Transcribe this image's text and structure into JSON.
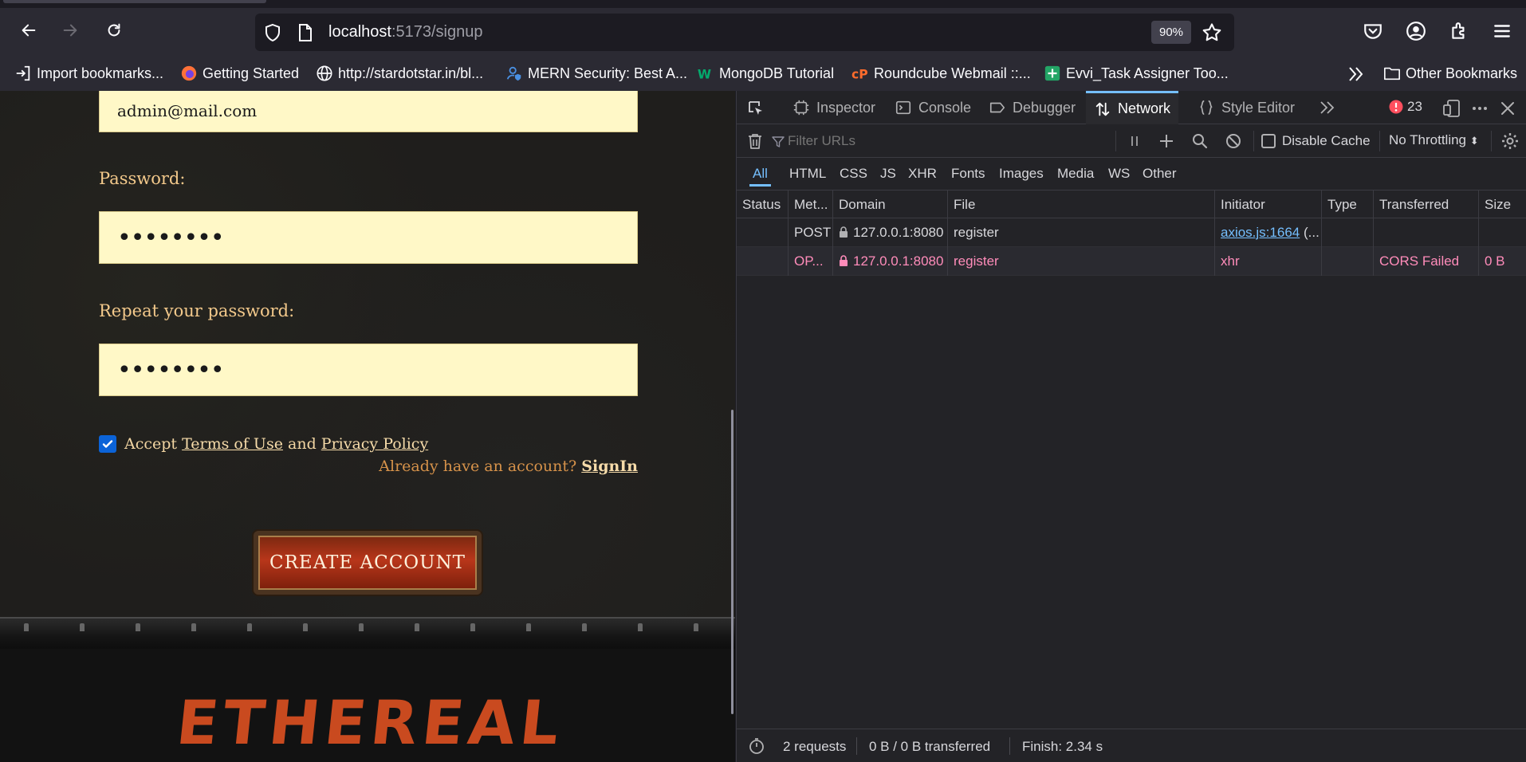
{
  "browser": {
    "url_host": "localhost",
    "url_rest": ":5173/signup",
    "zoom": "90%",
    "bookmarks": [
      "Import bookmarks...",
      "Getting Started",
      "http://stardotstar.in/bl...",
      "MERN Security: Best A...",
      "MongoDB Tutorial",
      "Roundcube Webmail ::...",
      "Evvi_Task Assigner Too..."
    ],
    "other_bookmarks": "Other Bookmarks"
  },
  "page": {
    "email_value": "admin@mail.com",
    "password_label": "Password:",
    "password_value": "••••••••",
    "repeat_label": "Repeat your password:",
    "repeat_value": "••••••••",
    "terms_accept": "Accept",
    "terms_of_use": "Terms of Use",
    "terms_and": "and",
    "privacy_policy": "Privacy Policy",
    "have_account": "Already have an account?",
    "signin": "SignIn",
    "create_account": "CREATE ACCOUNT",
    "logo": "ETHEREAL"
  },
  "devtools": {
    "tabs": [
      "Inspector",
      "Console",
      "Debugger",
      "Network",
      "Style Editor"
    ],
    "active_tab": "Network",
    "error_count": "23",
    "filter_placeholder": "Filter URLs",
    "disable_cache": "Disable Cache",
    "throttling": "No Throttling",
    "type_filters": [
      "All",
      "HTML",
      "CSS",
      "JS",
      "XHR",
      "Fonts",
      "Images",
      "Media",
      "WS",
      "Other"
    ],
    "columns": [
      "Status",
      "Met...",
      "Domain",
      "File",
      "Initiator",
      "Type",
      "Transferred",
      "Size"
    ],
    "requests": [
      {
        "status": "",
        "method": "POST",
        "domain": "127.0.0.1:8080",
        "file": "register",
        "initiator": "axios.js:1664",
        "initiator_extra": " (...",
        "type": "",
        "transferred": "",
        "size": ""
      },
      {
        "status": "",
        "method": "OP...",
        "domain": "127.0.0.1:8080",
        "file": "register",
        "initiator": "xhr",
        "initiator_extra": "",
        "type": "",
        "transferred": "CORS Failed",
        "size": "0 B"
      }
    ],
    "summary": {
      "requests": "2 requests",
      "transferred": "0 B / 0 B transferred",
      "finish": "Finish: 2.34 s"
    }
  },
  "colors": {
    "accent": "#75bfff",
    "error_text": "#ff8cba",
    "field_bg": "#fff8c7",
    "label_gold": "#f3c98b",
    "logo_red": "#c94a1f"
  }
}
